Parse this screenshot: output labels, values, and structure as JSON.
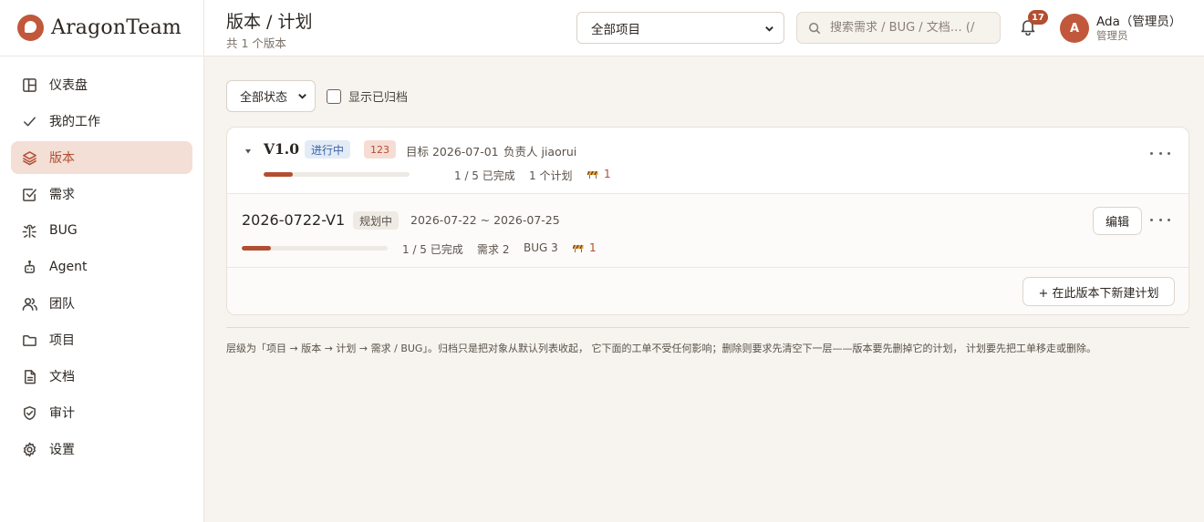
{
  "app": {
    "name": "AragonTeam",
    "brand_color": "#c1583b",
    "accent_color": "#b24e31"
  },
  "sidebar": {
    "items": [
      {
        "label": "仪表盘",
        "icon": "dashboard-icon"
      },
      {
        "label": "我的工作",
        "icon": "check-icon"
      },
      {
        "label": "版本",
        "icon": "layers-icon",
        "active": true
      },
      {
        "label": "需求",
        "icon": "checkbox-icon"
      },
      {
        "label": "BUG",
        "icon": "bug-icon"
      },
      {
        "label": "Agent",
        "icon": "robot-icon"
      },
      {
        "label": "团队",
        "icon": "users-icon"
      },
      {
        "label": "项目",
        "icon": "folder-icon"
      },
      {
        "label": "文档",
        "icon": "document-icon"
      },
      {
        "label": "审计",
        "icon": "shield-icon"
      },
      {
        "label": "设置",
        "icon": "gear-icon"
      }
    ]
  },
  "header": {
    "title": "版本 / 计划",
    "subtitle": "共 1 个版本",
    "project_select": "全部项目",
    "search_placeholder": "搜索需求 / BUG / 文档… (/",
    "notifications": "17",
    "user": {
      "avatar": "A",
      "name": "Ada（管理员）",
      "role": "管理员"
    }
  },
  "filters": {
    "status": "全部状态",
    "show_archived": "显示已归档",
    "show_archived_checked": false
  },
  "version": {
    "name": "V1.0",
    "status": "进行中",
    "count": "123",
    "target": "目标 2026-07-01",
    "owner": "负责人 jiaorui",
    "progress": 0.2,
    "done_text": "1 / 5 已完成",
    "plans_text": "1 个计划",
    "blockers": "1"
  },
  "plan": {
    "name": "2026-0722-V1",
    "status": "规划中",
    "dates": "2026-07-22 ~ 2026-07-25",
    "edit_label": "编辑",
    "progress": 0.2,
    "done_text": "1 / 5 已完成",
    "requirements_text": "需求 2",
    "bugs_text": "BUG 3",
    "blockers": "1"
  },
  "new_plan_label": "+ 在此版本下新建计划",
  "note": "层级为「项目 → 版本 → 计划 → 需求 / BUG」。归档只是把对象从默认列表收起， 它下面的工单不受任何影响；删除则要求先清空下一层——版本要先删掉它的计划， 计划要先把工单移走或删除。"
}
